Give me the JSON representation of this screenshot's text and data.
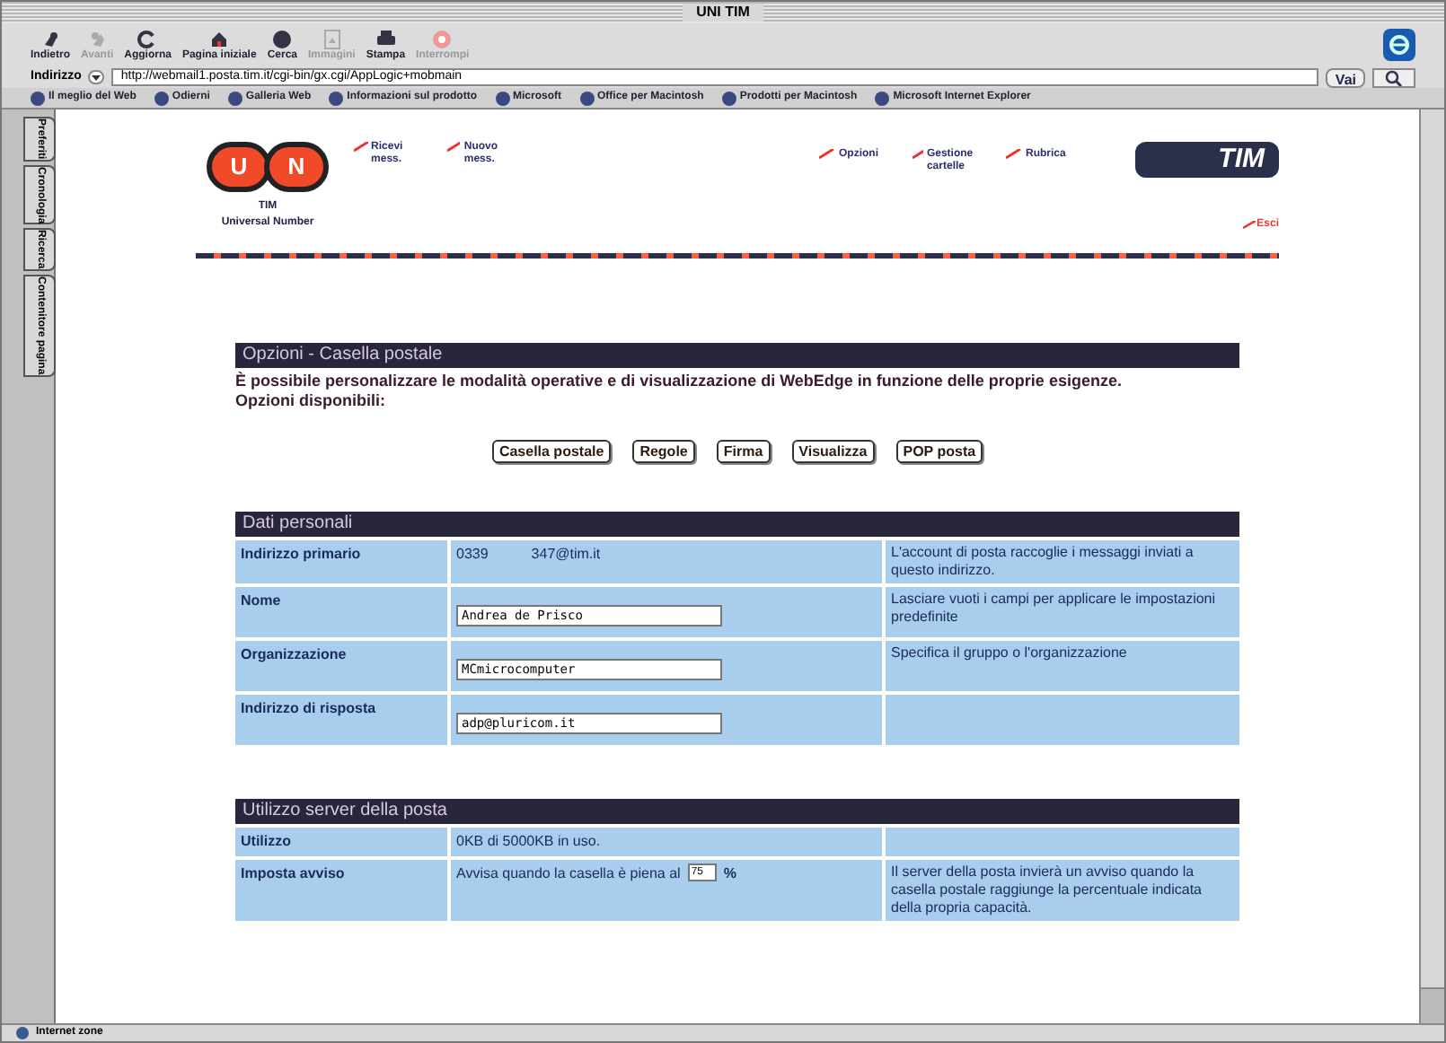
{
  "window": {
    "title": "UNI TIM"
  },
  "toolbar": [
    {
      "label": "Indietro",
      "disabled": false
    },
    {
      "label": "Avanti",
      "disabled": true
    },
    {
      "label": "Aggiorna",
      "disabled": false
    },
    {
      "label": "Pagina iniziale",
      "disabled": false
    },
    {
      "label": "Cerca",
      "disabled": false
    },
    {
      "label": "Immagini",
      "disabled": true
    },
    {
      "label": "Stampa",
      "disabled": false
    },
    {
      "label": "Interrompi",
      "disabled": true
    }
  ],
  "address_bar": {
    "label": "Indirizzo",
    "value": "http://webmail1.posta.tim.it/cgi-bin/gx.cgi/AppLogic+mobmain",
    "go": "Vai"
  },
  "favorites": [
    "Il meglio del Web",
    "Odierni",
    "Galleria Web",
    "Informazioni sul prodotto",
    "Microsoft",
    "Office per Macintosh",
    "Prodotti per Macintosh",
    "Microsoft Internet Explorer"
  ],
  "side_tabs": [
    "Preferiti",
    "Cronologia",
    "Ricerca",
    "Contenitore pagina"
  ],
  "header": {
    "logo_letters": [
      "U",
      "N"
    ],
    "logo_line1": "TIM",
    "logo_line2": "Universal Number",
    "brand": "TIM",
    "nav_left": [
      "Ricevi mess.",
      "Nuovo mess."
    ],
    "nav_right": [
      "Opzioni",
      "Gestione cartelle",
      "Rubrica"
    ],
    "exit": "Esci"
  },
  "options": {
    "title": "Opzioni - Casella postale",
    "intro": "È possibile personalizzare le modalità operative e di visualizzazione di WebEdge in funzione delle proprie esigenze.",
    "available": "Opzioni disponibili:",
    "buttons": [
      "Casella postale",
      "Regole",
      "Firma",
      "Visualizza",
      "POP posta"
    ]
  },
  "sections": [
    {
      "title": "Dati personali",
      "rows": [
        {
          "label": "Indirizzo primario",
          "kind": "text",
          "value": "0339",
          "value_2": "347@tim.it",
          "description": "L'account di posta raccoglie i messaggi inviati a questo indirizzo."
        },
        {
          "label": "Nome",
          "kind": "input",
          "value": "Andrea de Prisco",
          "description": "Lasciare vuoti i campi per applicare le impostazioni predefinite"
        },
        {
          "label": "Organizzazione",
          "kind": "input",
          "value": "MCmicrocomputer",
          "description": "Specifica il gruppo o l'organizzazione"
        },
        {
          "label": "Indirizzo di risposta",
          "kind": "input",
          "value": "adp@pluricom.it"
        }
      ]
    },
    {
      "title": "Utilizzo server della posta",
      "rows": [
        {
          "label": "Utilizzo",
          "kind": "text",
          "value": "0KB di 5000KB in uso."
        },
        {
          "label": "Imposta avviso",
          "kind": "threshold",
          "value": "Avvisa quando la casella è piena al",
          "input": "75",
          "unit": "%",
          "description": "Il server della posta invierà un avviso quando la casella postale raggiunge la percentuale indicata della propria capacità."
        }
      ]
    }
  ],
  "status_bar": "Internet zone"
}
